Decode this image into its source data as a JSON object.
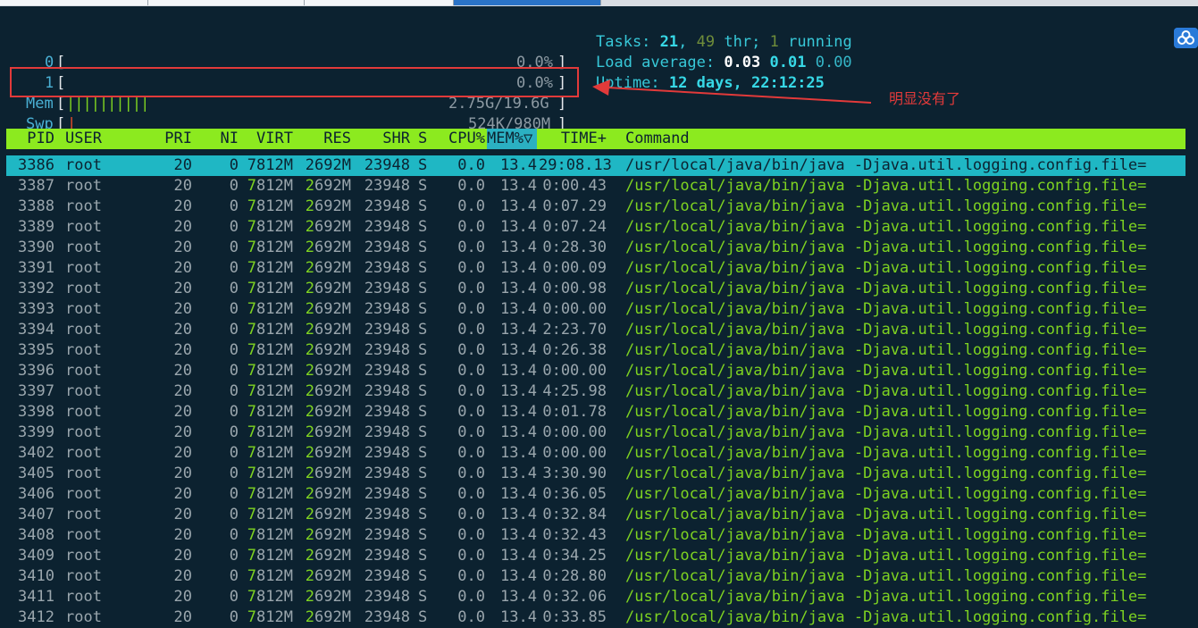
{
  "meters": {
    "cpu0": {
      "label": "0",
      "value": "0.0%"
    },
    "cpu1": {
      "label": "1",
      "value": "0.0%"
    },
    "mem": {
      "label": "Mem",
      "bars": "||||||||||",
      "value": "2.75G/19.6G"
    },
    "swp": {
      "label": "Swp",
      "bars": "|",
      "value": "524K/980M"
    }
  },
  "stats": {
    "tasks_label": "Tasks:",
    "tasks": "21",
    "threads": "49",
    "thr_label": "thr;",
    "running": "1",
    "running_label": "running",
    "load_label": "Load average:",
    "load1": "0.03",
    "load5": "0.01",
    "load15": "0.00",
    "uptime_label": "Uptime:",
    "uptime": "12 days, 22:12:25"
  },
  "annotation": {
    "text": "明显没有了"
  },
  "colors": {
    "annotation": "#e23a3a",
    "header_bg": "#8cea1f",
    "selected_bg": "#1fb7c4"
  },
  "table": {
    "columns": [
      "PID",
      "USER",
      "PRI",
      "NI",
      "VIRT",
      "RES",
      "SHR",
      "S",
      "CPU%",
      "MEM%▽",
      "TIME+",
      "Command"
    ],
    "rows": [
      [
        "3386",
        "root",
        "20",
        "0",
        "7812M",
        "2692M",
        "23948",
        "S",
        "0.0",
        "13.4",
        "29:08.13",
        "/usr/local/java/bin/java -Djava.util.logging.config.file="
      ],
      [
        "3387",
        "root",
        "20",
        "0",
        "7812M",
        "2692M",
        "23948",
        "S",
        "0.0",
        "13.4",
        "0:00.43",
        "/usr/local/java/bin/java -Djava.util.logging.config.file="
      ],
      [
        "3388",
        "root",
        "20",
        "0",
        "7812M",
        "2692M",
        "23948",
        "S",
        "0.0",
        "13.4",
        "0:07.29",
        "/usr/local/java/bin/java -Djava.util.logging.config.file="
      ],
      [
        "3389",
        "root",
        "20",
        "0",
        "7812M",
        "2692M",
        "23948",
        "S",
        "0.0",
        "13.4",
        "0:07.24",
        "/usr/local/java/bin/java -Djava.util.logging.config.file="
      ],
      [
        "3390",
        "root",
        "20",
        "0",
        "7812M",
        "2692M",
        "23948",
        "S",
        "0.0",
        "13.4",
        "0:28.30",
        "/usr/local/java/bin/java -Djava.util.logging.config.file="
      ],
      [
        "3391",
        "root",
        "20",
        "0",
        "7812M",
        "2692M",
        "23948",
        "S",
        "0.0",
        "13.4",
        "0:00.09",
        "/usr/local/java/bin/java -Djava.util.logging.config.file="
      ],
      [
        "3392",
        "root",
        "20",
        "0",
        "7812M",
        "2692M",
        "23948",
        "S",
        "0.0",
        "13.4",
        "0:00.98",
        "/usr/local/java/bin/java -Djava.util.logging.config.file="
      ],
      [
        "3393",
        "root",
        "20",
        "0",
        "7812M",
        "2692M",
        "23948",
        "S",
        "0.0",
        "13.4",
        "0:00.00",
        "/usr/local/java/bin/java -Djava.util.logging.config.file="
      ],
      [
        "3394",
        "root",
        "20",
        "0",
        "7812M",
        "2692M",
        "23948",
        "S",
        "0.0",
        "13.4",
        "2:23.70",
        "/usr/local/java/bin/java -Djava.util.logging.config.file="
      ],
      [
        "3395",
        "root",
        "20",
        "0",
        "7812M",
        "2692M",
        "23948",
        "S",
        "0.0",
        "13.4",
        "0:26.38",
        "/usr/local/java/bin/java -Djava.util.logging.config.file="
      ],
      [
        "3396",
        "root",
        "20",
        "0",
        "7812M",
        "2692M",
        "23948",
        "S",
        "0.0",
        "13.4",
        "0:00.00",
        "/usr/local/java/bin/java -Djava.util.logging.config.file="
      ],
      [
        "3397",
        "root",
        "20",
        "0",
        "7812M",
        "2692M",
        "23948",
        "S",
        "0.0",
        "13.4",
        "4:25.98",
        "/usr/local/java/bin/java -Djava.util.logging.config.file="
      ],
      [
        "3398",
        "root",
        "20",
        "0",
        "7812M",
        "2692M",
        "23948",
        "S",
        "0.0",
        "13.4",
        "0:01.78",
        "/usr/local/java/bin/java -Djava.util.logging.config.file="
      ],
      [
        "3399",
        "root",
        "20",
        "0",
        "7812M",
        "2692M",
        "23948",
        "S",
        "0.0",
        "13.4",
        "0:00.00",
        "/usr/local/java/bin/java -Djava.util.logging.config.file="
      ],
      [
        "3402",
        "root",
        "20",
        "0",
        "7812M",
        "2692M",
        "23948",
        "S",
        "0.0",
        "13.4",
        "0:00.00",
        "/usr/local/java/bin/java -Djava.util.logging.config.file="
      ],
      [
        "3405",
        "root",
        "20",
        "0",
        "7812M",
        "2692M",
        "23948",
        "S",
        "0.0",
        "13.4",
        "3:30.90",
        "/usr/local/java/bin/java -Djava.util.logging.config.file="
      ],
      [
        "3406",
        "root",
        "20",
        "0",
        "7812M",
        "2692M",
        "23948",
        "S",
        "0.0",
        "13.4",
        "0:36.05",
        "/usr/local/java/bin/java -Djava.util.logging.config.file="
      ],
      [
        "3407",
        "root",
        "20",
        "0",
        "7812M",
        "2692M",
        "23948",
        "S",
        "0.0",
        "13.4",
        "0:32.84",
        "/usr/local/java/bin/java -Djava.util.logging.config.file="
      ],
      [
        "3408",
        "root",
        "20",
        "0",
        "7812M",
        "2692M",
        "23948",
        "S",
        "0.0",
        "13.4",
        "0:32.43",
        "/usr/local/java/bin/java -Djava.util.logging.config.file="
      ],
      [
        "3409",
        "root",
        "20",
        "0",
        "7812M",
        "2692M",
        "23948",
        "S",
        "0.0",
        "13.4",
        "0:34.25",
        "/usr/local/java/bin/java -Djava.util.logging.config.file="
      ],
      [
        "3410",
        "root",
        "20",
        "0",
        "7812M",
        "2692M",
        "23948",
        "S",
        "0.0",
        "13.4",
        "0:28.80",
        "/usr/local/java/bin/java -Djava.util.logging.config.file="
      ],
      [
        "3411",
        "root",
        "20",
        "0",
        "7812M",
        "2692M",
        "23948",
        "S",
        "0.0",
        "13.4",
        "0:32.06",
        "/usr/local/java/bin/java -Djava.util.logging.config.file="
      ],
      [
        "3412",
        "root",
        "20",
        "0",
        "7812M",
        "2692M",
        "23948",
        "S",
        "0.0",
        "13.4",
        "0:33.85",
        "/usr/local/java/bin/java -Djava.util.logging.config.file="
      ]
    ]
  }
}
